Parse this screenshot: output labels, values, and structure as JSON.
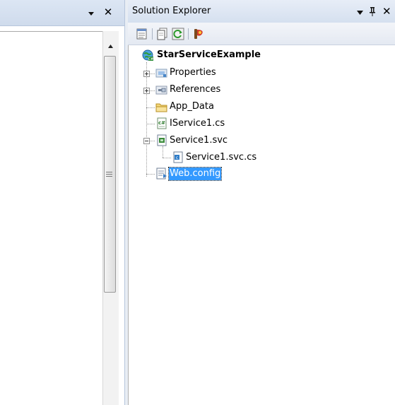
{
  "left_panel": {
    "close_glyph": "✕"
  },
  "solution_explorer": {
    "title": "Solution Explorer",
    "pin_glyph": "ᵖ",
    "close_glyph": "✕",
    "toolbar": [
      {
        "name": "properties-icon"
      },
      {
        "name": "show-all-files-icon"
      },
      {
        "name": "refresh-icon"
      },
      {
        "name": "view-class-diagram-icon"
      }
    ],
    "tree": {
      "root": {
        "label": "StarServiceExample",
        "icon": "web-project-icon"
      },
      "items": [
        {
          "label": "Properties",
          "icon": "properties-folder-icon",
          "expander": "plus"
        },
        {
          "label": "References",
          "icon": "references-folder-icon",
          "expander": "plus"
        },
        {
          "label": "App_Data",
          "icon": "folder-icon",
          "expander": "none"
        },
        {
          "label": "IService1.cs",
          "icon": "csharp-file-icon",
          "expander": "none"
        },
        {
          "label": "Service1.svc",
          "icon": "svc-file-icon",
          "expander": "minus"
        },
        {
          "label": "Service1.svc.cs",
          "icon": "csharp-code-file-icon",
          "expander": "none",
          "child": true
        },
        {
          "label": "Web.config",
          "icon": "config-file-icon",
          "expander": "none",
          "selected": true
        }
      ]
    }
  }
}
